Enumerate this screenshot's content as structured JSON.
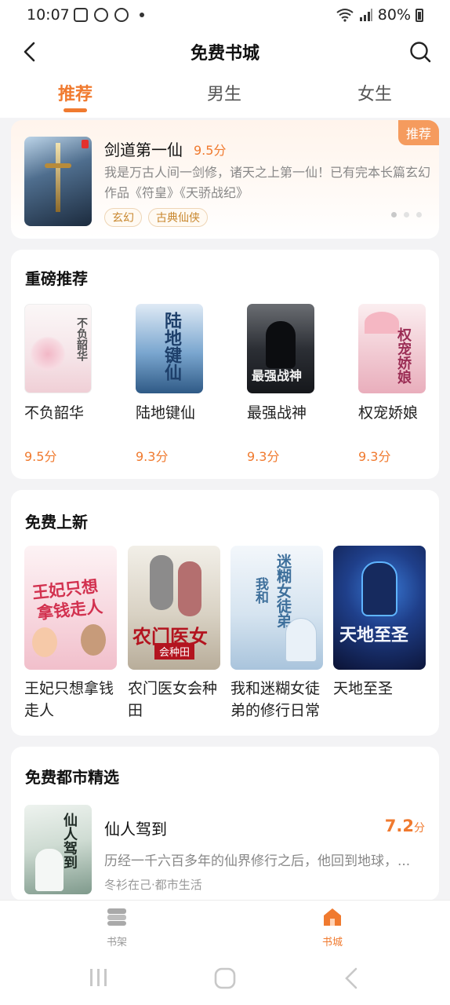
{
  "status_bar": {
    "time": "10:07",
    "battery": "80%"
  },
  "header": {
    "title": "免费书城"
  },
  "tabs": [
    {
      "label": "推荐",
      "active": true
    },
    {
      "label": "男生",
      "active": false
    },
    {
      "label": "女生",
      "active": false
    }
  ],
  "featured": {
    "badge": "推荐",
    "name": "剑道第一仙",
    "score": "9.5分",
    "desc": "我是万古人间一剑修，诸天之上第一仙！已有完本长篇玄幻作品《符皇》《天骄战纪》",
    "tags": [
      "玄幻",
      "古典仙侠"
    ]
  },
  "heavy": {
    "title": "重磅推荐",
    "items": [
      {
        "name": "不负韶华",
        "score": "9.5分"
      },
      {
        "name": "陆地键仙",
        "score": "9.3分"
      },
      {
        "name": "最强战神",
        "score": "9.3分"
      },
      {
        "name": "权宠娇娘",
        "score": "9.3分"
      }
    ]
  },
  "free_new": {
    "title": "免费上新",
    "items": [
      {
        "name": "王妃只想拿钱走人"
      },
      {
        "name": "农门医女会种田"
      },
      {
        "name": "我和迷糊女徒弟的修行日常"
      },
      {
        "name": "天地至圣"
      }
    ]
  },
  "city": {
    "title": "免费都市精选",
    "item": {
      "name": "仙人驾到",
      "score_num": "7.2",
      "score_unit": "分",
      "desc": "历经一千六百多年的仙界修行之后，他回到地球，...",
      "meta": "冬衫在己·都市生活"
    }
  },
  "bottom_nav": [
    {
      "label": "书架",
      "active": false
    },
    {
      "label": "书城",
      "active": true
    }
  ],
  "colors": {
    "accent": "#f07a2f"
  }
}
